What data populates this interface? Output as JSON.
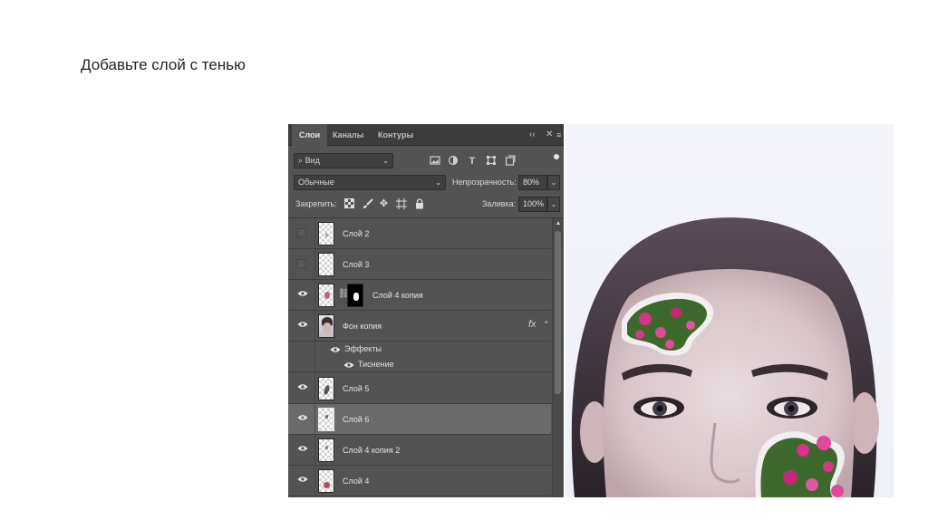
{
  "slide": {
    "title": "Добавьте слой с тенью"
  },
  "panel": {
    "tabs": [
      "Слои",
      "Каналы",
      "Контуры"
    ],
    "filter": {
      "label": "Вид"
    },
    "blend_mode": "Обычные",
    "opacity_label": "Непрозрачность:",
    "opacity_value": "80%",
    "lock_label": "Закрепить:",
    "fill_label": "Заливка:",
    "fill_value": "100%",
    "layers": [
      {
        "name": "Слой 2",
        "visible": false
      },
      {
        "name": "Слой 3",
        "visible": false
      },
      {
        "name": "Слой 4 копия",
        "visible": true
      },
      {
        "name": "Фон копия",
        "visible": true,
        "fx": "fx"
      },
      {
        "name": "Слой 5",
        "visible": true
      },
      {
        "name": "Слой 6",
        "visible": true,
        "selected": true
      },
      {
        "name": "Слой 4 копия 2",
        "visible": true
      },
      {
        "name": "Слой 4",
        "visible": true
      }
    ],
    "effects": {
      "label": "Эффекты",
      "items": [
        "Тиснение"
      ]
    }
  },
  "colors": {
    "panel_bg": "#535353",
    "tab_bg": "#3c3c3c",
    "selected_row": "#6a6a6a"
  }
}
